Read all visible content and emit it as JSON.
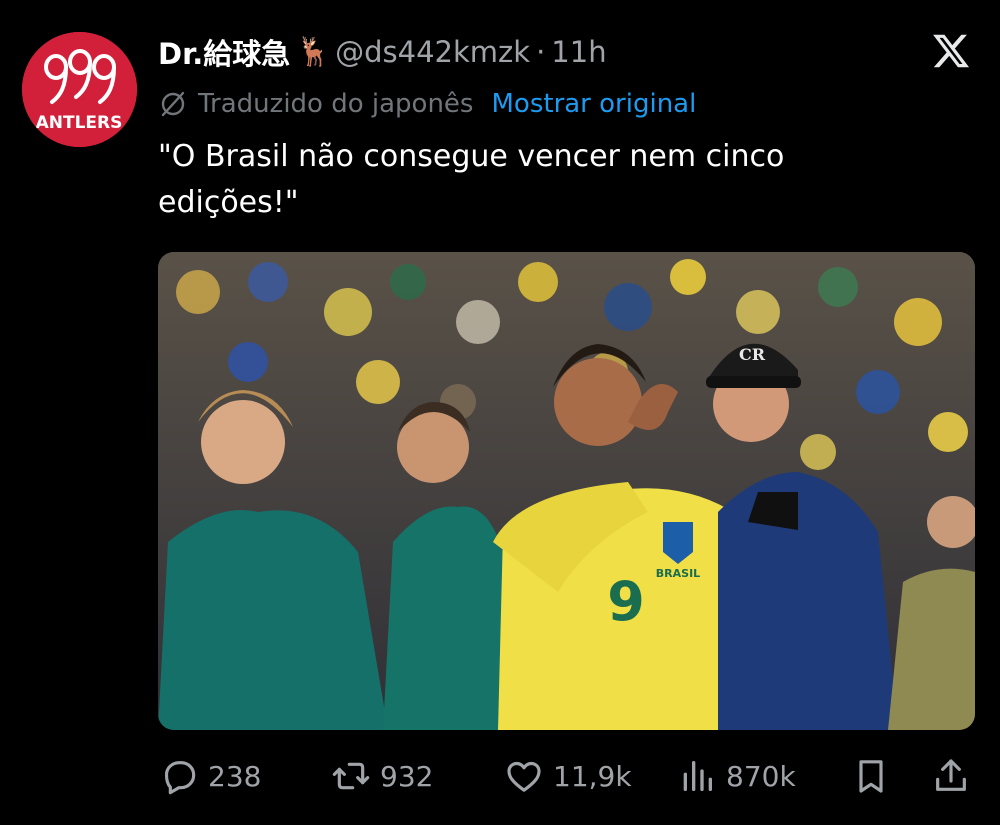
{
  "author": {
    "display_name": "Dr.給球急",
    "emoji": "🦌",
    "handle": "@ds442kmzk",
    "separator": "·",
    "time_ago": "11h",
    "avatar": {
      "logo_numbers": "999",
      "logo_word": "ANTLERS",
      "bg_color": "#d3203a"
    }
  },
  "translation": {
    "label": "Traduzido do japonês",
    "show_original": "Mostrar original",
    "link_color": "#1d9bf0"
  },
  "post": {
    "text": "\"O Brasil não consegue vencer nem cinco edições!\""
  },
  "media": {
    "jersey_number": "9",
    "jersey_text": "BRASIL",
    "cap_logo": "CR"
  },
  "actions": {
    "replies": "238",
    "reposts": "932",
    "likes": "11,9k",
    "views": "870k"
  },
  "icons": {
    "close": "x-logo-icon",
    "translate": "globe-slash-icon",
    "reply": "reply-icon",
    "repost": "repost-icon",
    "like": "heart-icon",
    "views": "views-chart-icon",
    "bookmark": "bookmark-icon",
    "share": "share-icon"
  }
}
